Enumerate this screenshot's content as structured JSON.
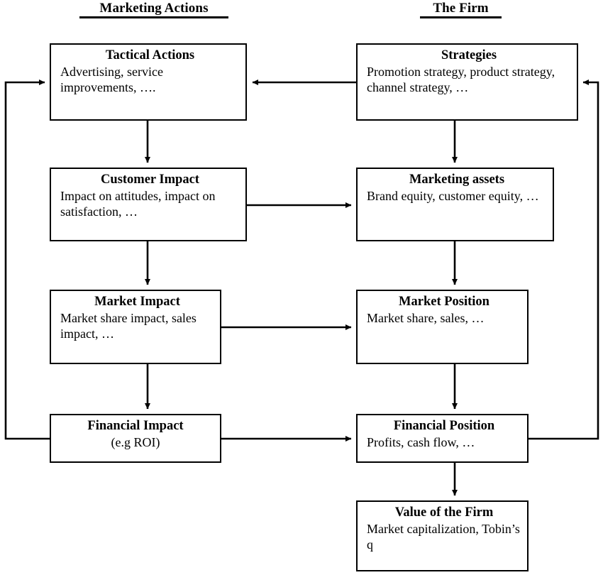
{
  "diagram": {
    "headers": [
      {
        "id": "marketing-actions",
        "label": "Marketing Actions"
      },
      {
        "id": "the-firm",
        "label": "The Firm"
      }
    ],
    "nodes": [
      {
        "id": "tactical-actions",
        "title": "Tactical Actions",
        "body": "Advertising, service improvements, ….",
        "column": "Marketing Actions"
      },
      {
        "id": "strategies",
        "title": "Strategies",
        "body": "Promotion strategy, product strategy, channel strategy, …",
        "column": "The Firm"
      },
      {
        "id": "customer-impact",
        "title": "Customer Impact",
        "body": "Impact on attitudes, impact on satisfaction, …",
        "column": "Marketing Actions"
      },
      {
        "id": "marketing-assets",
        "title": "Marketing assets",
        "body": "Brand equity, customer equity, …",
        "column": "The Firm"
      },
      {
        "id": "market-impact",
        "title": "Market Impact",
        "body": "Market share impact, sales impact, …",
        "column": "Marketing Actions"
      },
      {
        "id": "market-position",
        "title": "Market Position",
        "body": "Market share, sales, …",
        "column": "The Firm"
      },
      {
        "id": "financial-impact",
        "title": "Financial Impact",
        "body": "(e.g ROI)",
        "column": "Marketing Actions"
      },
      {
        "id": "financial-position",
        "title": "Financial Position",
        "body": "Profits, cash flow, …",
        "column": "The Firm"
      },
      {
        "id": "value-of-the-firm",
        "title": "Value of the Firm",
        "body": "Market capitalization, Tobin’s q",
        "column": "The Firm"
      }
    ],
    "edges": [
      {
        "id": "strategies-to-tactical-actions",
        "from": "strategies",
        "to": "tactical-actions",
        "kind": "horizontal-arrow"
      },
      {
        "id": "tactical-actions-to-customer-impact",
        "from": "tactical-actions",
        "to": "customer-impact",
        "kind": "vertical-arrow"
      },
      {
        "id": "strategies-to-marketing-assets",
        "from": "strategies",
        "to": "marketing-assets",
        "kind": "vertical-arrow"
      },
      {
        "id": "customer-impact-to-marketing-assets",
        "from": "customer-impact",
        "to": "marketing-assets",
        "kind": "horizontal-arrow"
      },
      {
        "id": "customer-impact-to-market-impact",
        "from": "customer-impact",
        "to": "market-impact",
        "kind": "vertical-arrow"
      },
      {
        "id": "marketing-assets-to-market-position",
        "from": "marketing-assets",
        "to": "market-position",
        "kind": "vertical-arrow"
      },
      {
        "id": "market-impact-to-market-position",
        "from": "market-impact",
        "to": "market-position",
        "kind": "horizontal-arrow"
      },
      {
        "id": "market-impact-to-financial-impact",
        "from": "market-impact",
        "to": "financial-impact",
        "kind": "vertical-arrow"
      },
      {
        "id": "market-position-to-financial-position",
        "from": "market-position",
        "to": "financial-position",
        "kind": "vertical-arrow"
      },
      {
        "id": "financial-impact-to-financial-position",
        "from": "financial-impact",
        "to": "financial-position",
        "kind": "horizontal-arrow"
      },
      {
        "id": "financial-position-to-value-of-the-firm",
        "from": "financial-position",
        "to": "value-of-the-firm",
        "kind": "vertical-arrow"
      },
      {
        "id": "financial-impact-feedback-to-tactical-actions",
        "from": "financial-impact",
        "to": "tactical-actions",
        "kind": "feedback-loop-left"
      },
      {
        "id": "financial-position-feedback-to-strategies",
        "from": "financial-position",
        "to": "strategies",
        "kind": "feedback-loop-right"
      }
    ],
    "colors": {
      "line": "#000000",
      "box_border": "#000000",
      "box_fill": "#ffffff",
      "text": "#000000",
      "background": "#ffffff"
    }
  }
}
